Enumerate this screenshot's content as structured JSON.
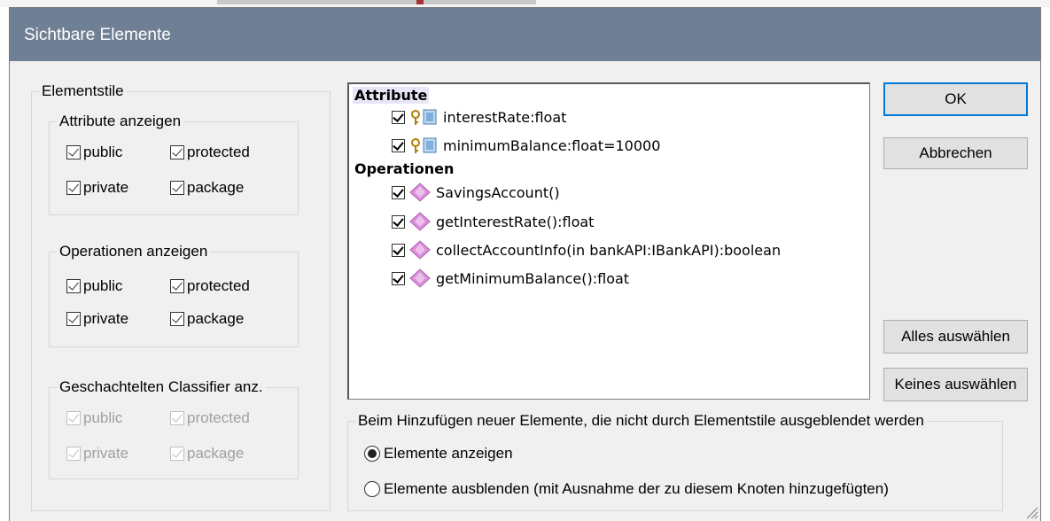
{
  "dialog": {
    "title": "Sichtbare Elemente"
  },
  "element_styles": {
    "title": "Elementstile",
    "attributes": {
      "title": "Attribute anzeigen",
      "public": "public",
      "protected": "protected",
      "private": "private",
      "package": "package"
    },
    "operations": {
      "title": "Operationen anzeigen",
      "public": "public",
      "protected": "protected",
      "private": "private",
      "package": "package"
    },
    "nested": {
      "title": "Geschachtelten Classifier anz.",
      "public": "public",
      "protected": "protected",
      "private": "private",
      "package": "package"
    }
  },
  "list": {
    "attributes_header": "Attribute",
    "attributes": [
      {
        "label": "interestRate:float",
        "checked": true,
        "icon": "key-field-icon"
      },
      {
        "label": "minimumBalance:float=10000",
        "checked": true,
        "icon": "key-field-icon"
      }
    ],
    "operations_header": "Operationen",
    "operations": [
      {
        "label": "SavingsAccount()",
        "checked": true,
        "icon": "operation-diamond-icon"
      },
      {
        "label": "getInterestRate():float",
        "checked": true,
        "icon": "operation-diamond-icon"
      },
      {
        "label": "collectAccountInfo(in bankAPI:IBankAPI):boolean",
        "checked": true,
        "icon": "operation-diamond-icon"
      },
      {
        "label": "getMinimumBalance():float",
        "checked": true,
        "icon": "operation-diamond-icon"
      }
    ]
  },
  "buttons": {
    "ok": "OK",
    "cancel": "Abbrechen",
    "select_all": "Alles auswählen",
    "select_none": "Keines auswählen"
  },
  "new_elements": {
    "title": "Beim Hinzufügen neuer Elemente, die nicht durch Elementstile ausgeblendet werden",
    "show": "Elemente anzeigen",
    "hide": "Elemente ausblenden (mit Ausnahme der zu diesem Knoten hinzugefügten)",
    "selected": "show"
  },
  "colors": {
    "titlebar": "#6f7f94",
    "default_button_border": "#0078d7",
    "operation_icon": "#d98fd9"
  }
}
